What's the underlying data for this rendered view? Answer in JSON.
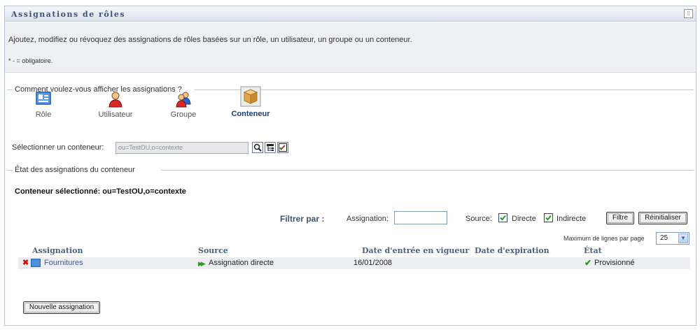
{
  "panel": {
    "title": "Assignations de rôles",
    "menu_icon": "grip-icon",
    "intro": "Ajoutez, modifiez ou révoquez des assignations de rôles basées sur un rôle, un utilisateur, un groupe ou un conteneur.",
    "required_note": "* - = obligatoire."
  },
  "view_section": {
    "legend": "Comment voulez-vous afficher les assignations ?",
    "options": [
      {
        "label": "Rôle",
        "icon": "role-card-icon",
        "selected": false
      },
      {
        "label": "Utilisateur",
        "icon": "user-icon",
        "selected": false
      },
      {
        "label": "Groupe",
        "icon": "group-icon",
        "selected": false
      },
      {
        "label": "Conteneur",
        "icon": "container-box-icon",
        "selected": true
      }
    ],
    "select_label": "Sélectionner un conteneur:",
    "select_value": "ou=TestOU,o=contexte"
  },
  "status_section": {
    "legend": "État des assignations du conteneur",
    "selected_container": "Conteneur sélectionné: ou=TestOU,o=contexte",
    "filter_label": "Filtrer par :",
    "assignment_label": "Assignation:",
    "assignment_value": "",
    "source_label": "Source:",
    "direct_label": "Directe",
    "direct_checked": true,
    "indirect_label": "Indirecte",
    "indirect_checked": true,
    "filter_button": "Filtre",
    "reset_button": "Réinitialiser",
    "max_rows_label": "Maximum de lignes par page",
    "max_rows_value": "25",
    "columns": [
      "Assignation",
      "Source",
      "Date d'entrée en vigueur",
      "Date d'expiration",
      "État"
    ],
    "rows": [
      {
        "assignment": "Fournitures",
        "source": "Assignation directe",
        "effective_date": "16/01/2008",
        "expiration_date": "",
        "state": "Provisionné"
      }
    ],
    "new_button": "Nouvelle assignation"
  },
  "colors": {
    "title": "#3c5279",
    "header_bg": "#dde3ec",
    "intro_bg": "#eef0f4",
    "link": "#3c5a8f",
    "ok_green": "#2a9a20",
    "delete_red": "#cc1111"
  }
}
